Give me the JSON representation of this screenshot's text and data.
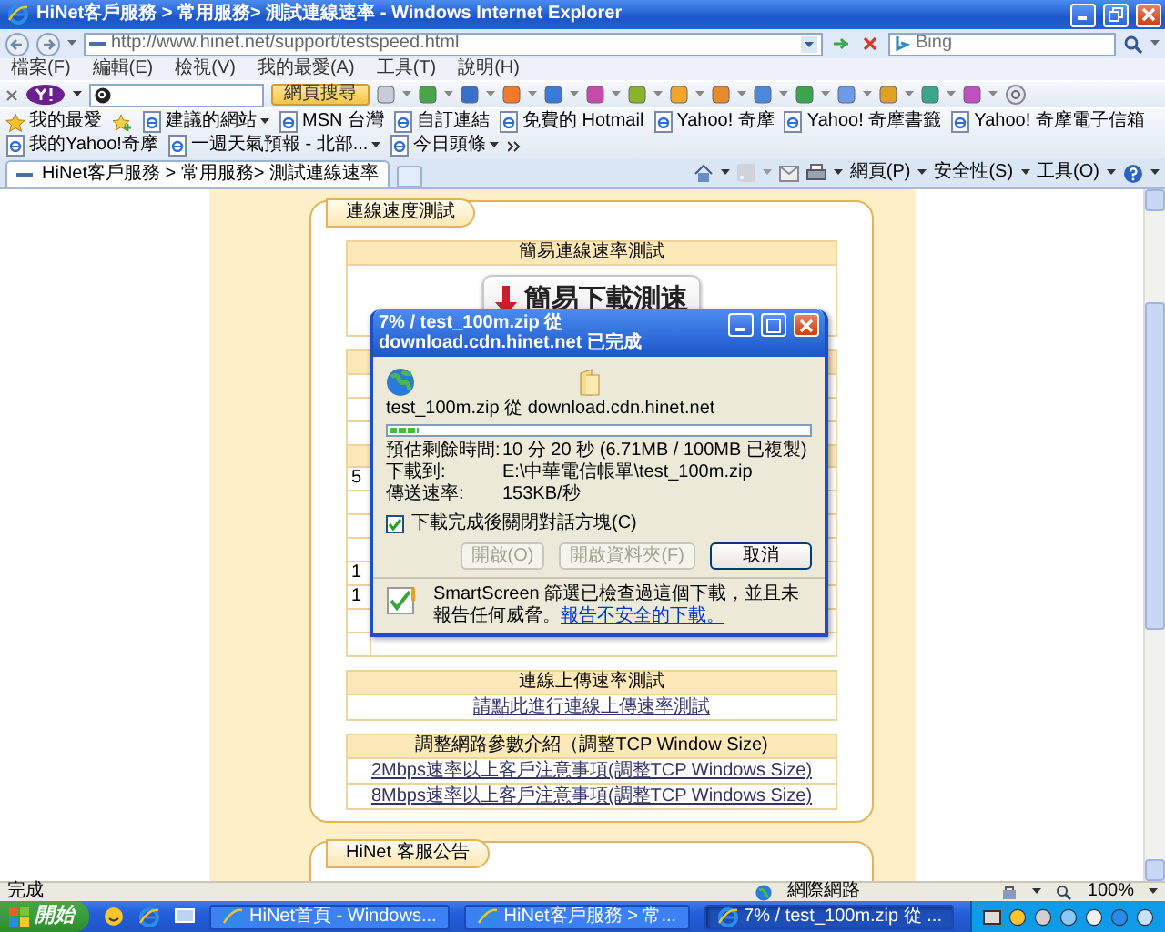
{
  "window": {
    "title": "HiNet客戶服務 > 常用服務> 測試連線速率 - Windows Internet Explorer"
  },
  "address_bar": {
    "url": "http://www.hinet.net/support/testspeed.html",
    "search_placeholder": "Bing"
  },
  "menu": [
    "檔案(F)",
    "編輯(E)",
    "檢視(V)",
    "我的最愛(A)",
    "工具(T)",
    "說明(H)"
  ],
  "yahoo_toolbar": {
    "search_button": "網頁搜尋"
  },
  "favorites_bar": {
    "label": "我的最愛",
    "items": [
      {
        "label": "建議的網站",
        "dropdown": true
      },
      {
        "label": "MSN 台灣",
        "dropdown": false
      },
      {
        "label": "自訂連結",
        "dropdown": false
      },
      {
        "label": "免費的 Hotmail",
        "dropdown": false
      },
      {
        "label": "Yahoo! 奇摩",
        "dropdown": false
      },
      {
        "label": "Yahoo! 奇摩書籤",
        "dropdown": false
      },
      {
        "label": "Yahoo! 奇摩電子信箱",
        "dropdown": false
      },
      {
        "label": "我的Yahoo!奇摩",
        "dropdown": false
      },
      {
        "label": "一週天氣預報 - 北部...",
        "dropdown": true
      },
      {
        "label": "今日頭條",
        "dropdown": true
      }
    ]
  },
  "tabs": [
    {
      "label": "HiNet客戶服務 > 常用服務> 測試連線速率",
      "selected": true
    }
  ],
  "command_bar": [
    "網頁(P)",
    "安全性(S)",
    "工具(O)"
  ],
  "page": {
    "panels": [
      {
        "title": "連線速度測試",
        "tables": [
          {
            "rows": [
              {
                "kind": "header",
                "text": "簡易連線速率測試"
              },
              {
                "kind": "button",
                "text": "簡易下載測速"
              }
            ]
          },
          {
            "rows": [
              {
                "kind": "header"
              },
              {
                "kind": "cell"
              },
              {
                "kind": "cell"
              },
              {
                "kind": "cell"
              },
              {
                "kind": "header"
              },
              {
                "kind": "cell",
                "text": "5"
              },
              {
                "kind": "cell"
              },
              {
                "kind": "cell"
              },
              {
                "kind": "cell"
              },
              {
                "kind": "cell",
                "text": "1"
              },
              {
                "kind": "cell",
                "text": "1"
              },
              {
                "kind": "cell"
              },
              {
                "kind": "cell"
              }
            ]
          },
          {
            "rows": [
              {
                "kind": "header",
                "text": "連線上傳速率測試"
              },
              {
                "kind": "link",
                "text": "請點此進行連線上傳速率測試"
              }
            ]
          },
          {
            "rows": [
              {
                "kind": "header",
                "text": "調整網路參數介紹（調整TCP Window Size)"
              },
              {
                "kind": "link",
                "text": "2Mbps速率以上客戶注意事項(調整TCP Windows Size)"
              },
              {
                "kind": "link",
                "text": "8Mbps速率以上客戶注意事項(調整TCP Windows Size)"
              }
            ]
          }
        ]
      },
      {
        "title": "HiNet 客服公告"
      }
    ]
  },
  "download_dialog": {
    "title": "7% / test_100m.zip 從 download.cdn.hinet.net 已完成",
    "source": "test_100m.zip 從 download.cdn.hinet.net",
    "level": 0.07,
    "details": [
      {
        "label": "預估剩餘時間:",
        "value": "10 分 20 秒 (6.71MB / 100MB 已複製)"
      },
      {
        "label": "下載到:",
        "value": "E:\\中華電信帳單\\test_100m.zip"
      },
      {
        "label": "傳送速率:",
        "value": "153KB/秒"
      }
    ],
    "close_when_done": {
      "label": "下載完成後關閉對話方塊(C)",
      "checked": true
    },
    "buttons": [
      {
        "label": "開啟(O)",
        "disabled": true
      },
      {
        "label": "開啟資料夾(F)",
        "disabled": true
      },
      {
        "label": "取消",
        "disabled": false
      }
    ],
    "notice": "SmartScreen 篩選已檢查過這個下載，並且未報告任何威脅。",
    "notice_link": "報告不安全的下載。"
  },
  "status_bar": {
    "text": "完成",
    "zone": "網際網路",
    "zoom": "100%"
  },
  "taskbar": {
    "start": "開始",
    "tasks": [
      {
        "label": "HiNet首頁 - Windows...",
        "selected": false
      },
      {
        "label": "HiNet客戶服務 > 常...",
        "selected": false
      },
      {
        "label": "7% / test_100m.zip 從 ...",
        "selected": true
      }
    ]
  }
}
